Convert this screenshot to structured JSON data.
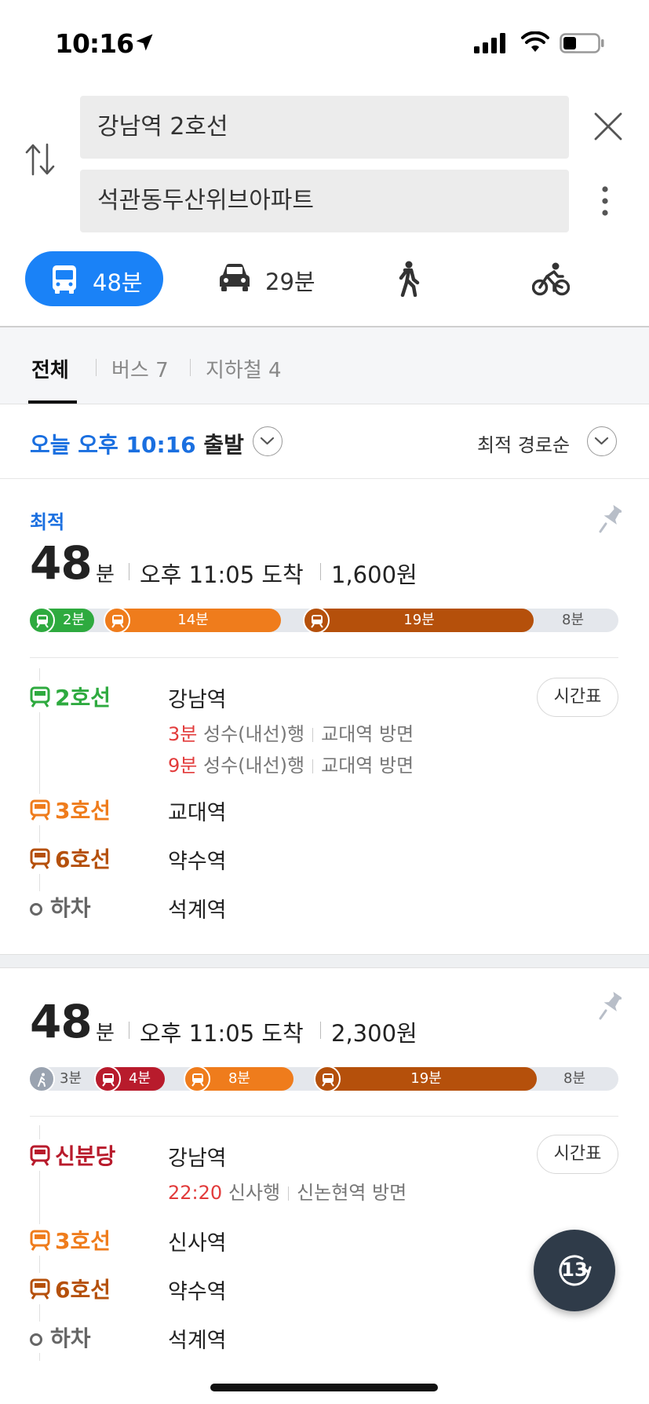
{
  "status": {
    "time": "10:16"
  },
  "search": {
    "origin": "강남역 2호선",
    "destination": "석관동두산위브아파트"
  },
  "modes": {
    "transit_time": "48분",
    "car_time": "29분"
  },
  "tabs": {
    "all": "전체",
    "bus": "버스 7",
    "subway": "지하철 4"
  },
  "departure": {
    "prefix": "오늘 오후 10:16",
    "suffix": " 출발",
    "sort": "최적 경로순"
  },
  "colors": {
    "line2": "#2eaa3f",
    "line3": "#ef7c1c",
    "line6": "#b5500b",
    "shinbundang": "#b81b2c",
    "accent": "#1a82f7"
  },
  "routes": [
    {
      "badge": "최적",
      "minutes": "48",
      "min_unit": "분",
      "arrive": "오후 11:05 도착",
      "fare": "1,600원",
      "bar": {
        "seg1": "2분",
        "seg2": "14분",
        "seg3": "19분",
        "remain": "8분"
      },
      "steps": [
        {
          "line": "2호선",
          "station": "강남역"
        },
        {
          "line": "3호선",
          "station": "교대역"
        },
        {
          "line": "6호선",
          "station": "약수역"
        },
        {
          "line": "하차",
          "station": "석계역"
        }
      ],
      "eta": [
        {
          "time": "3분",
          "dir": "성수(내선)행",
          "toward": "교대역 방면"
        },
        {
          "time": "9분",
          "dir": "성수(내선)행",
          "toward": "교대역 방면"
        }
      ],
      "timetable": "시간표"
    },
    {
      "minutes": "48",
      "min_unit": "분",
      "arrive": "오후 11:05 도착",
      "fare": "2,300원",
      "bar": {
        "walk": "3분",
        "seg1": "4분",
        "seg2": "8분",
        "seg3": "19분",
        "remain": "8분"
      },
      "steps": [
        {
          "line": "신분당",
          "station": "강남역"
        },
        {
          "line": "3호선",
          "station": "신사역"
        },
        {
          "line": "6호선",
          "station": "약수역"
        },
        {
          "line": "하차",
          "station": "석계역"
        }
      ],
      "eta": [
        {
          "time": "22:20",
          "dir": "신사행",
          "toward": "신논현역 방면"
        }
      ],
      "timetable": "시간표"
    }
  ],
  "fab": {
    "label": "13"
  }
}
